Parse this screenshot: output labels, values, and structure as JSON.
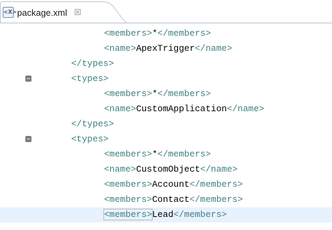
{
  "tab": {
    "icon": "xml-file-icon",
    "label": "package.xml",
    "close_glyph": "☒"
  },
  "colors": {
    "tag": "#3f7f7f",
    "text": "#000000",
    "current_line": "#e8f2fe",
    "fold_marker": "#7d7d7d"
  },
  "lines": [
    {
      "open": "<members>",
      "content": "*",
      "close": "</members>",
      "indent": 2
    },
    {
      "open": "<name>",
      "content": "ApexTrigger",
      "close": "</name>",
      "indent": 2
    },
    {
      "open": "</types>",
      "content": "",
      "close": "",
      "indent": 1
    },
    {
      "open": "<types>",
      "content": "",
      "close": "",
      "indent": 1,
      "fold": true
    },
    {
      "open": "<members>",
      "content": "*",
      "close": "</members>",
      "indent": 2
    },
    {
      "open": "<name>",
      "content": "CustomApplication",
      "close": "</name>",
      "indent": 2
    },
    {
      "open": "</types>",
      "content": "",
      "close": "",
      "indent": 1
    },
    {
      "open": "<types>",
      "content": "",
      "close": "",
      "indent": 1,
      "fold": true
    },
    {
      "open": "<members>",
      "content": "*",
      "close": "</members>",
      "indent": 2
    },
    {
      "open": "<name>",
      "content": "CustomObject",
      "close": "</name>",
      "indent": 2
    },
    {
      "open": "<members>",
      "content": "Account",
      "close": "</members>",
      "indent": 2
    },
    {
      "open": "<members>",
      "content": "Contact",
      "close": "</members>",
      "indent": 2
    },
    {
      "open": "<members>",
      "content": "Lead",
      "close": "</members>",
      "indent": 2,
      "current": true
    }
  ]
}
